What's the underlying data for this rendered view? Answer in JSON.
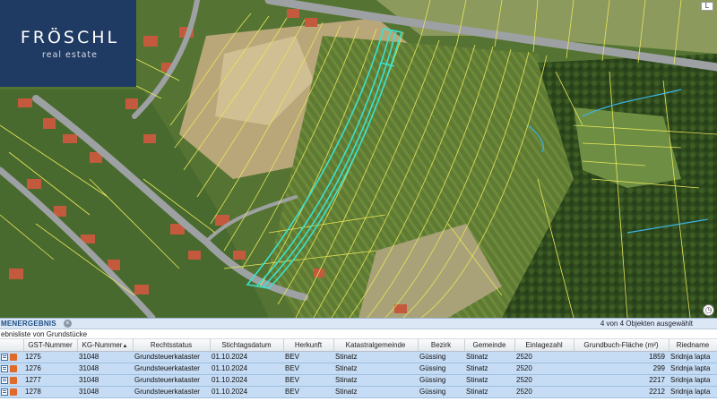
{
  "brand": {
    "name": "FRÖSCHL",
    "tagline": "real estate"
  },
  "map": {
    "controls": {
      "corner_icon": "L",
      "clock_icon": "clock-icon"
    },
    "colors": {
      "parcel_line": "#e7e65a",
      "selected_parcel": "#39e3d0",
      "road": "#9ea1a3",
      "water": "#3cb3e6"
    }
  },
  "results": {
    "title": "MENERGEBNIS",
    "count_text": "4 von 4 Objekten ausgewählt",
    "subtitle": "ebnisliste von Grundstücke",
    "columns": [
      "",
      "GST-Nummer",
      "KG-Nummer",
      "Rechtsstatus",
      "Stichtagsdatum",
      "Herkunft",
      "Katastralgemeinde",
      "Bezirk",
      "Gemeinde",
      "Einlagezahl",
      "Grundbuch-Fläche (m²)",
      "Riedname"
    ],
    "rows": [
      {
        "gst": "1275",
        "kg": "31048",
        "status": "Grundsteuerkataster",
        "datum": "01.10.2024",
        "herkunft": "BEV",
        "kat": "Stinatz",
        "bezirk": "Güssing",
        "gemeinde": "Stinatz",
        "ez": "2520",
        "flaeche": "1859",
        "ried": "Sridnja lapta"
      },
      {
        "gst": "1276",
        "kg": "31048",
        "status": "Grundsteuerkataster",
        "datum": "01.10.2024",
        "herkunft": "BEV",
        "kat": "Stinatz",
        "bezirk": "Güssing",
        "gemeinde": "Stinatz",
        "ez": "2520",
        "flaeche": "299",
        "ried": "Sridnja lapta"
      },
      {
        "gst": "1277",
        "kg": "31048",
        "status": "Grundsteuerkataster",
        "datum": "01.10.2024",
        "herkunft": "BEV",
        "kat": "Stinatz",
        "bezirk": "Güssing",
        "gemeinde": "Stinatz",
        "ez": "2520",
        "flaeche": "2217",
        "ried": "Sridnja lapta"
      },
      {
        "gst": "1278",
        "kg": "31048",
        "status": "Grundsteuerkataster",
        "datum": "01.10.2024",
        "herkunft": "BEV",
        "kat": "Stinatz",
        "bezirk": "Güssing",
        "gemeinde": "Stinatz",
        "ez": "2520",
        "flaeche": "2212",
        "ried": "Sridnja lapta"
      }
    ]
  }
}
